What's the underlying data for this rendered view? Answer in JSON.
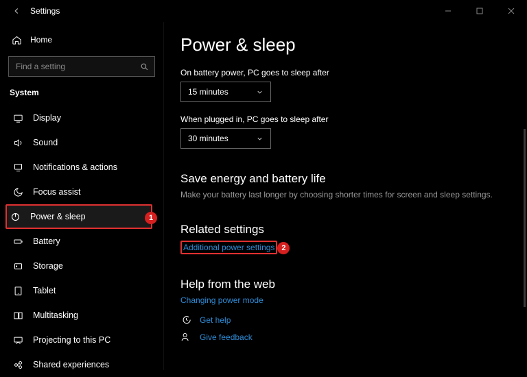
{
  "window": {
    "title": "Settings"
  },
  "sidebar": {
    "home_label": "Home",
    "search_placeholder": "Find a setting",
    "section_label": "System",
    "items": [
      {
        "label": "Display"
      },
      {
        "label": "Sound"
      },
      {
        "label": "Notifications & actions"
      },
      {
        "label": "Focus assist"
      },
      {
        "label": "Power & sleep"
      },
      {
        "label": "Battery"
      },
      {
        "label": "Storage"
      },
      {
        "label": "Tablet"
      },
      {
        "label": "Multitasking"
      },
      {
        "label": "Projecting to this PC"
      },
      {
        "label": "Shared experiences"
      }
    ]
  },
  "annotations": {
    "badge1": "1",
    "badge2": "2"
  },
  "main": {
    "title": "Power & sleep",
    "sleep_battery_label": "On battery power, PC goes to sleep after",
    "sleep_battery_value": "15 minutes",
    "sleep_plugged_label": "When plugged in, PC goes to sleep after",
    "sleep_plugged_value": "30 minutes",
    "energy_heading": "Save energy and battery life",
    "energy_body": "Make your battery last longer by choosing shorter times for screen and sleep settings.",
    "related_heading": "Related settings",
    "related_link": "Additional power settings",
    "help_heading": "Help from the web",
    "help_link": "Changing power mode",
    "get_help": "Get help",
    "give_feedback": "Give feedback"
  }
}
